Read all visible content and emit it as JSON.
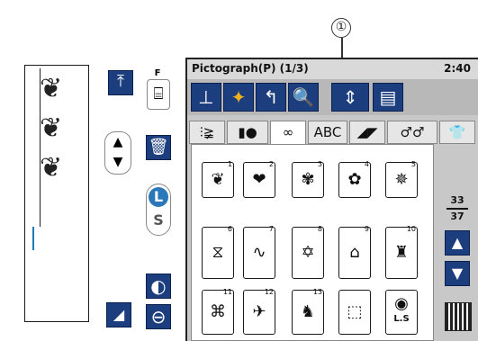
{
  "callout": {
    "label": "①"
  },
  "screen": {
    "title": "Pictograph(P) (1/3)",
    "time": "2:40",
    "page": {
      "current": "33",
      "total": "37"
    }
  },
  "left_panel": {
    "foot_label": "F",
    "l_label": "L",
    "s_label": "S"
  },
  "toolbar_icons": [
    "presser-foot-icon",
    "stitch-preview-icon",
    "undo-arrow-icon",
    "zoom-icon",
    "mirror-image-icon",
    "memory-list-icon"
  ],
  "tabs": [
    {
      "label": "⫶≩",
      "name": "tab-utility"
    },
    {
      "label": "▮●",
      "name": "tab-buttonhole"
    },
    {
      "label": "∞",
      "name": "tab-decorative"
    },
    {
      "label": "ABC",
      "name": "tab-alphabet"
    },
    {
      "label": "◢◤",
      "name": "tab-quilting"
    },
    {
      "label": "♂♂",
      "name": "tab-satin"
    },
    {
      "label": "👕",
      "name": "tab-clothing"
    }
  ],
  "stitches": [
    {
      "num": "1",
      "glyph": "❦"
    },
    {
      "num": "2",
      "glyph": "❤"
    },
    {
      "num": "3",
      "glyph": "✾"
    },
    {
      "num": "4",
      "glyph": "✿"
    },
    {
      "num": "5",
      "glyph": "✵"
    },
    {
      "num": "6",
      "glyph": "⧖"
    },
    {
      "num": "7",
      "glyph": "∿"
    },
    {
      "num": "8",
      "glyph": "✡"
    },
    {
      "num": "9",
      "glyph": "⌂"
    },
    {
      "num": "10",
      "glyph": "♜"
    },
    {
      "num": "11",
      "glyph": "⌘"
    },
    {
      "num": "12",
      "glyph": "✈"
    },
    {
      "num": "13",
      "glyph": "♞"
    },
    {
      "num": "",
      "glyph": "⬚"
    },
    {
      "num": "",
      "glyph": "◉"
    }
  ],
  "ls_label": "L.S"
}
